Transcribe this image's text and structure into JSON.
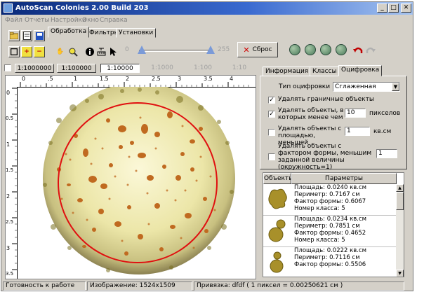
{
  "window": {
    "title": "AutoScan Colonies 2.00 Build 203"
  },
  "menu": [
    "Файл",
    "Отчеты",
    "Настройки",
    "Окно",
    "Справка"
  ],
  "toolbar": {
    "tabs": [
      "Обработка",
      "Фильтры",
      "Установки"
    ],
    "active_tab": "Обработка",
    "slider_min": "0",
    "slider_max": "255",
    "reset_label": "Сброс"
  },
  "scales": [
    "1:1000000",
    "1:100000",
    "1:10000",
    "1:1000",
    "1:100",
    "1:10"
  ],
  "active_scale": "1:10000",
  "ruler": {
    "h_ticks": [
      "0",
      ".5",
      "1",
      "1.5",
      "2",
      "2.5",
      "3",
      "3.5",
      "4"
    ],
    "v_ticks": [
      "0",
      "0.5",
      "1",
      "1.5",
      "2",
      "2.5",
      "3",
      "3.5"
    ]
  },
  "panel": {
    "tabs": [
      "Информация",
      "Классы",
      "Оцифровка"
    ],
    "active_tab": "Оцифровка",
    "type_label": "Тип оцифровки",
    "type_value": "Сглаженная",
    "opt_boundary": "Удалять граничные объекты",
    "opt_pixels": "Удалять объекты, в которых менее чем",
    "pixels_value": "10",
    "pixels_unit": "пикселов",
    "opt_area": "Удалять объекты с площадью, меньшей",
    "area_value": "1",
    "area_unit": "кв.см",
    "opt_form": "Удалять объекты с фактором формы, меньшим заданной величины (окружность=1)",
    "form_value": "1"
  },
  "objects_table": {
    "headers": [
      "Объекты",
      "Параметры"
    ],
    "rows": [
      {
        "area": "Площадь: 0.0240 кв.см",
        "perimeter": "Периметр: 0.7167 см",
        "form": "Фактор формы: 0.6067",
        "class": "Номер класса: 5"
      },
      {
        "area": "Площадь: 0.0234 кв.см",
        "perimeter": "Периметр: 0.7851 см",
        "form": "Фактор формы: 0.4652",
        "class": "Номер класса: 5"
      },
      {
        "area": "Площадь: 0.0222 кв.см",
        "perimeter": "Периметр: 0.7116 см",
        "form": "Фактор формы: 0.5506",
        "class": ""
      }
    ]
  },
  "status": {
    "ready": "Готовность к работе",
    "image": "Изображение: 1524x1509",
    "binding": "Привязка: dfdf ( 1 пиксел = 0.00250621 см )"
  },
  "colors": {
    "title_start": "#0a2a7a",
    "title_end": "#a6c4f0",
    "circle": "#e01010"
  }
}
